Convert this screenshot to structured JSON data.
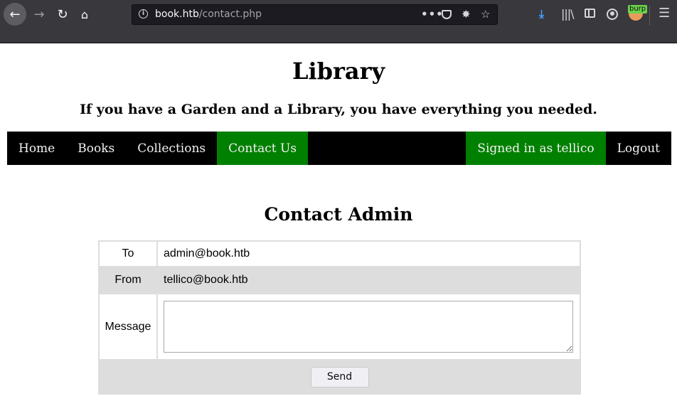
{
  "browser": {
    "url_host": "book.htb",
    "url_path": "/contact.php",
    "burp_badge": "burp",
    "icons": [
      "back-icon",
      "forward-icon",
      "reload-icon",
      "home-icon",
      "info-icon",
      "page-actions-icon",
      "pocket-icon",
      "bug-icon",
      "bookmark-star-icon",
      "download-icon",
      "library-icon",
      "sidebar-icon",
      "account-icon",
      "burp-extension-icon",
      "menu-icon"
    ]
  },
  "site": {
    "title": "Library",
    "tagline": "If you have a Garden and a Library, you have everything you needed."
  },
  "nav": {
    "home": "Home",
    "books": "Books",
    "collections": "Collections",
    "contact": "Contact Us",
    "signed_in": "Signed in as tellico",
    "logout": "Logout",
    "active_color": "#008000"
  },
  "contact": {
    "title": "Contact Admin",
    "to_label": "To",
    "to_value": "admin@book.htb",
    "from_label": "From",
    "from_value": "tellico@book.htb",
    "message_label": "Message",
    "message_value": "",
    "send_label": "Send"
  }
}
